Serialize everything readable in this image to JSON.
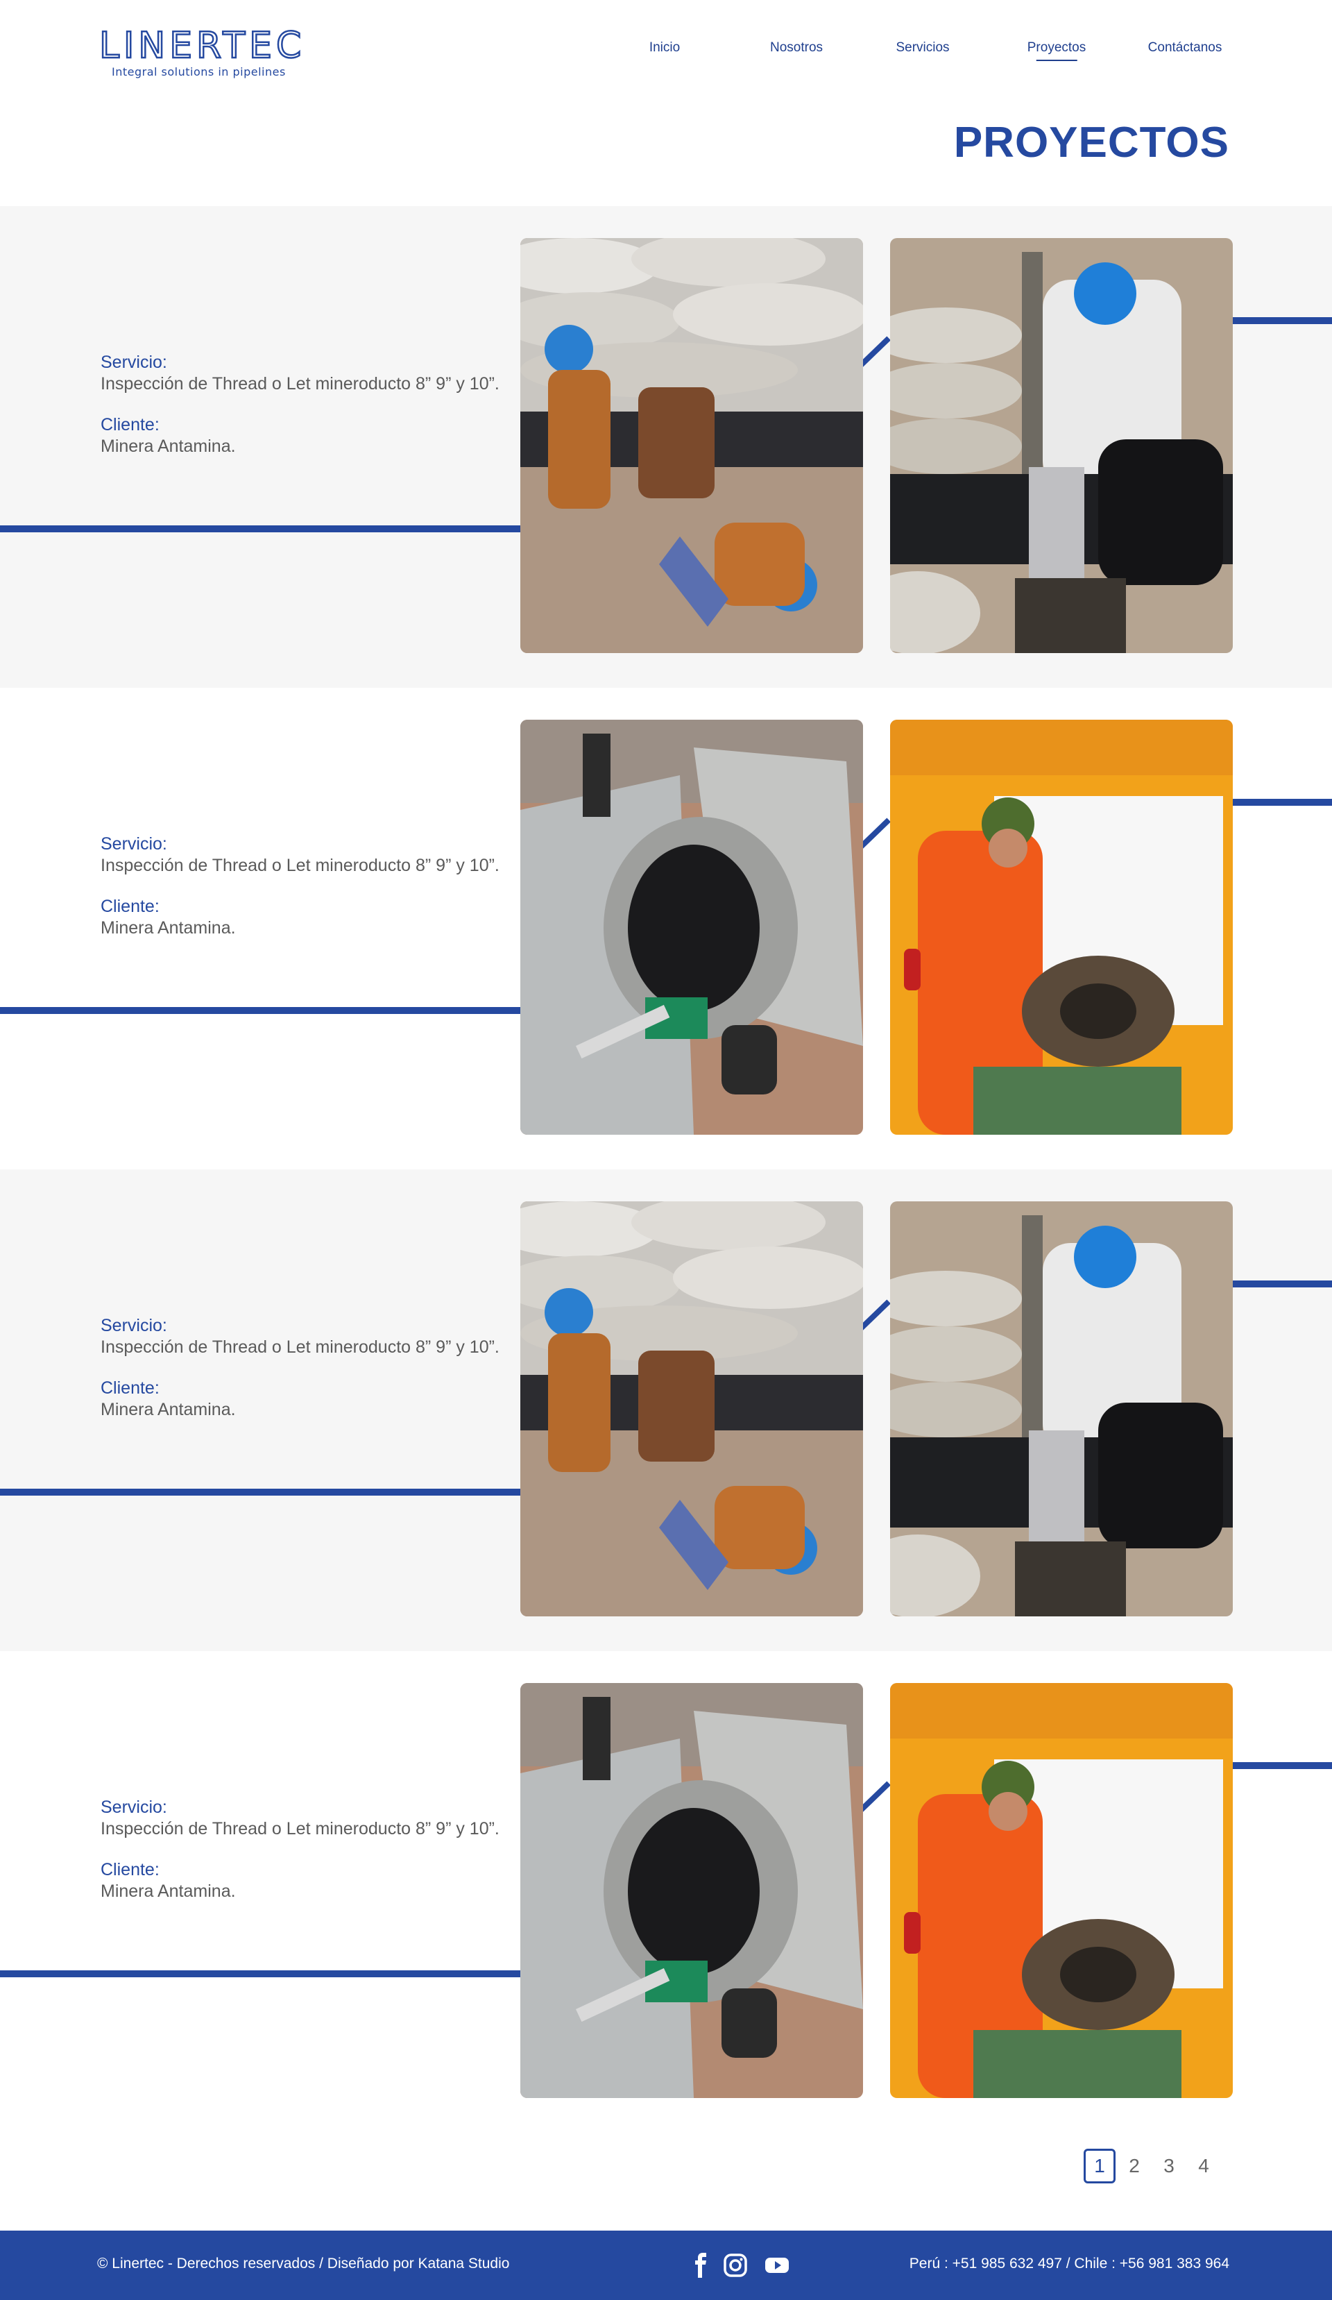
{
  "header": {
    "logo_text": "LINERTEC",
    "logo_tagline": "Integral solutions in pipelines",
    "nav": [
      {
        "label": "Inicio",
        "active": false
      },
      {
        "label": "Nosotros",
        "active": false
      },
      {
        "label": "Servicios",
        "active": false
      },
      {
        "label": "Proyectos",
        "active": true
      },
      {
        "label": "Contáctanos",
        "active": false
      }
    ]
  },
  "page_title": "PROYECTOS",
  "projects": [
    {
      "service_label": "Servicio:",
      "service": "Inspección de Thread o Let mineroducto 8” 9” y 10”.",
      "client_label": "Cliente:",
      "client": "Minera Antamina."
    },
    {
      "service_label": "Servicio:",
      "service": "Inspección de Thread o Let mineroducto 8” 9” y 10”.",
      "client_label": "Cliente:",
      "client": "Minera Antamina."
    },
    {
      "service_label": "Servicio:",
      "service": "Inspección de Thread o Let mineroducto 8” 9” y 10”.",
      "client_label": "Cliente:",
      "client": "Minera Antamina."
    },
    {
      "service_label": "Servicio:",
      "service": "Inspección de Thread o Let mineroducto 8” 9” y 10”.",
      "client_label": "Cliente:",
      "client": "Minera Antamina."
    }
  ],
  "pagination": {
    "pages": [
      "1",
      "2",
      "3",
      "4"
    ],
    "current": "1"
  },
  "footer": {
    "copyright": "© Linertec - Derechos reservados / Diseñado por Katana Studio",
    "contact": "Perú : +51 985 632 497  / Chile : +56 981 383 964",
    "social_icons": [
      "facebook-icon",
      "instagram-icon",
      "youtube-icon"
    ]
  },
  "colors": {
    "brand_blue": "#2549a0",
    "row_gray": "#f6f6f6"
  }
}
